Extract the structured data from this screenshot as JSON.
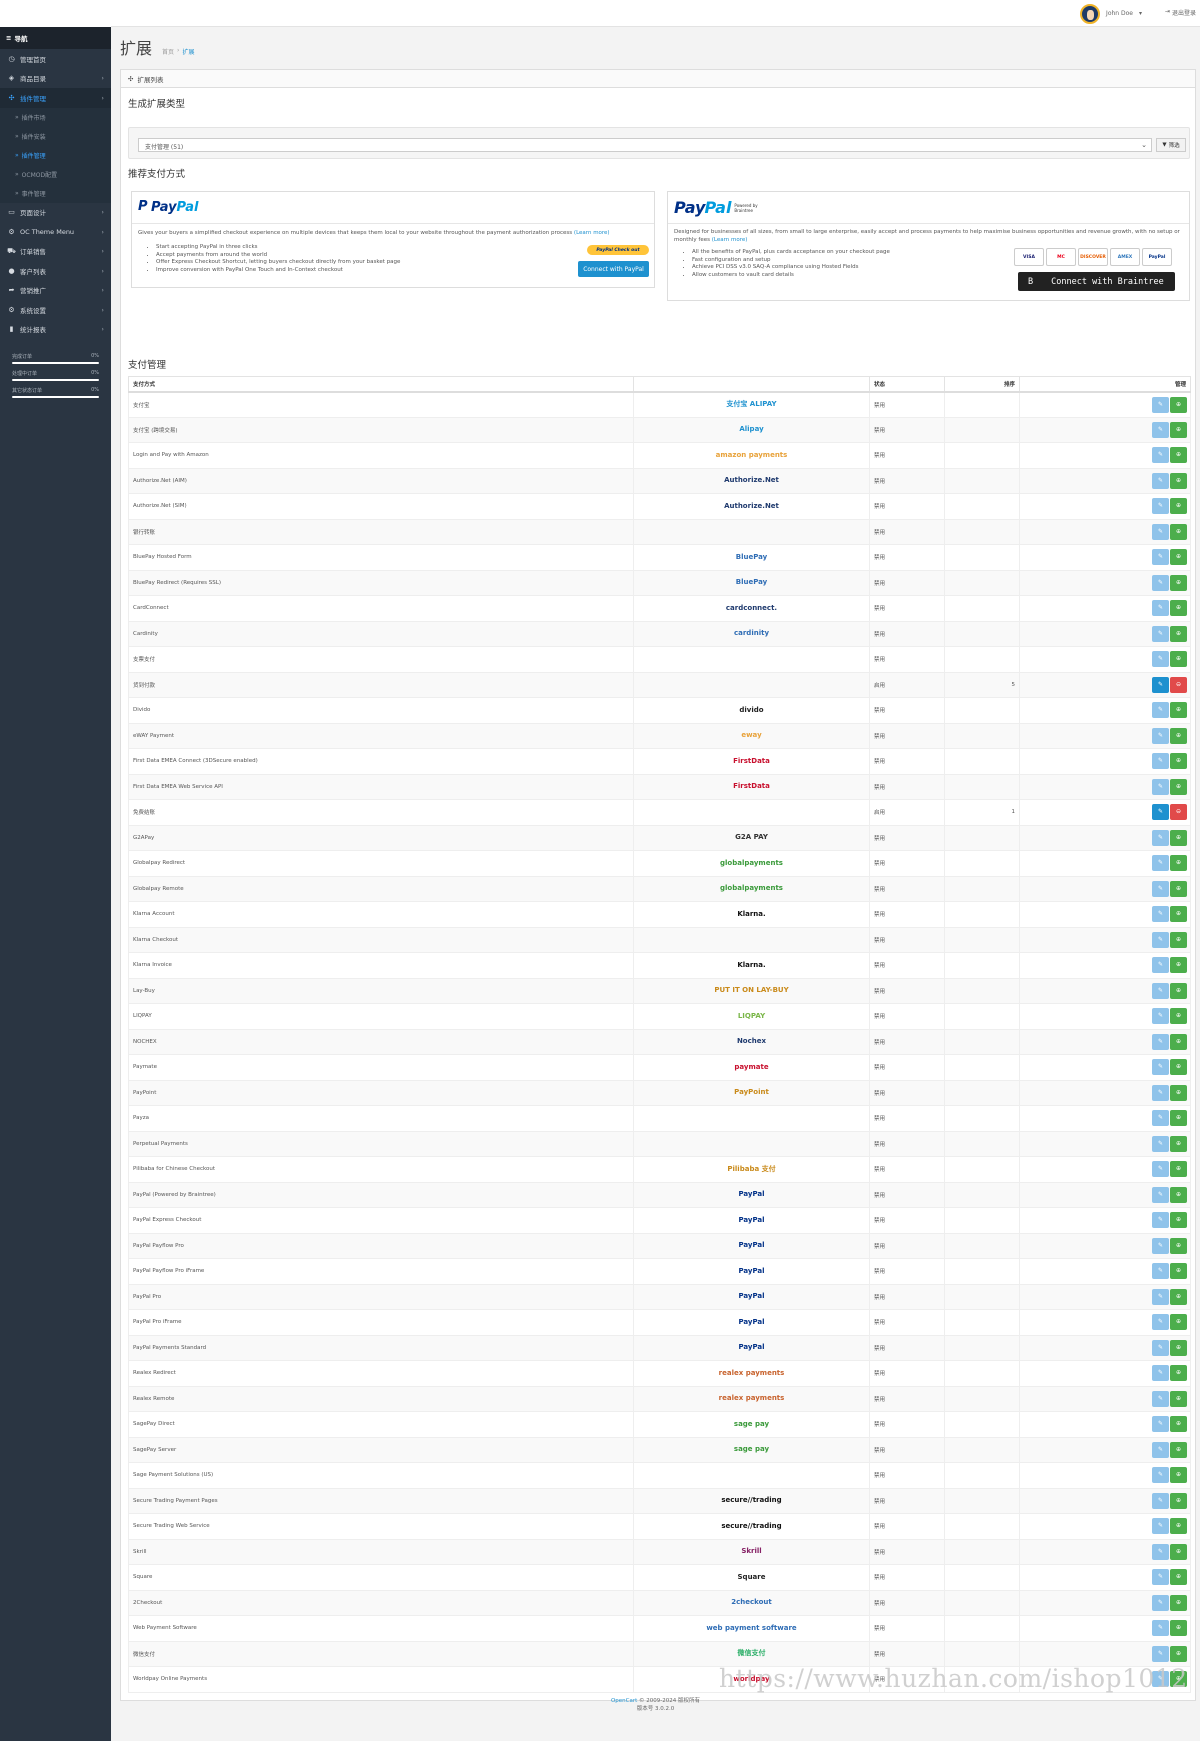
{
  "header": {
    "user_name": "John Doe",
    "logout": "退出登录"
  },
  "sidebar": {
    "nav_title": "导航",
    "items": [
      {
        "label": "管理首页",
        "icon": "dashboard-icon",
        "glyph": "◷",
        "has_children": false,
        "active": false
      },
      {
        "label": "商品目录",
        "icon": "tag-icon",
        "glyph": "◈",
        "has_children": true,
        "active": false
      },
      {
        "label": "插件管理",
        "icon": "puzzle-icon",
        "glyph": "✣",
        "has_children": true,
        "active": true,
        "children": [
          {
            "label": "插件市场",
            "active": false
          },
          {
            "label": "插件安装",
            "active": false
          },
          {
            "label": "插件管理",
            "active": true
          },
          {
            "label": "OCMOD配置",
            "active": false
          },
          {
            "label": "事件管理",
            "active": false
          }
        ]
      },
      {
        "label": "页面设计",
        "icon": "monitor-icon",
        "glyph": "▭",
        "has_children": true,
        "active": false
      },
      {
        "label": "OC Theme Menu",
        "icon": "gear-icon",
        "glyph": "⚙",
        "has_children": true,
        "active": false
      },
      {
        "label": "订单销售",
        "icon": "cart-icon",
        "glyph": "⛟",
        "has_children": true,
        "active": false
      },
      {
        "label": "客户列表",
        "icon": "user-icon",
        "glyph": "●",
        "has_children": true,
        "active": false
      },
      {
        "label": "营销推广",
        "icon": "share-icon",
        "glyph": "➦",
        "has_children": true,
        "active": false
      },
      {
        "label": "系统设置",
        "icon": "cog-icon",
        "glyph": "⚙",
        "has_children": true,
        "active": false
      },
      {
        "label": "统计报表",
        "icon": "bar-chart-icon",
        "glyph": "▮",
        "has_children": true,
        "active": false
      }
    ],
    "progress": [
      {
        "label": "完成订单",
        "value": "0%",
        "fraction": 0.0
      },
      {
        "label": "处理中订单",
        "value": "0%",
        "fraction": 0.0
      },
      {
        "label": "其它状态订单",
        "value": "0%",
        "fraction": 0.0
      }
    ]
  },
  "page": {
    "title": "扩展",
    "breadcrumb": [
      "首页",
      "扩展"
    ],
    "panel_title": "扩展列表",
    "type_section_title": "生成扩展类型",
    "type_select_value": "支付管理 (51)",
    "filter_button": "筛选",
    "recommended_title": "推荐支付方式",
    "payment_section_title": "支付管理"
  },
  "promo_paypal": {
    "logo_a": "Pay",
    "logo_b": "Pal",
    "description": "Gives your buyers a simplified checkout experience on multiple devices that keeps them local to your website throughout the payment authorization process",
    "learn_more": "(Learn more)",
    "bullets": [
      "Start accepting PayPal in three clicks",
      "Accept payments from around the world",
      "Offer Express Checkout Shortcut, letting buyers checkout directly from your basket page",
      "Improve conversion with PayPal One Touch and In-Context checkout"
    ],
    "checkout_button": "PayPal Check out",
    "connect_button": "Connect with PayPal"
  },
  "promo_braintree": {
    "logo_a": "Pay",
    "logo_b": "Pal",
    "powered_by": "Powered by Braintree",
    "description": "Designed for businesses of all sizes, from small to large enterprise, easily accept and process payments to help maximise business opportunities and revenue growth, with no setup or monthly fees",
    "learn_more": "(Learn more)",
    "bullets": [
      "All the benefits of PayPal, plus cards acceptance on your checkout page",
      "Fast configuration and setup",
      "Achieve PCI DSS v3.0 SAQ-A compliance using Hosted Fields",
      "Allow customers to vault card details"
    ],
    "cards": [
      "VISA",
      "MC",
      "DISCOVER",
      "AMEX",
      "PayPal"
    ],
    "connect_button": "Connect with Braintree",
    "connect_badge": "B"
  },
  "table": {
    "headers": [
      "支付方式",
      "",
      "状态",
      "排序",
      "管理"
    ],
    "rows": [
      {
        "name": "支付宝",
        "logo": "支付宝 ALIPAY",
        "logo_color": "#1e91cf",
        "status": "禁用",
        "sort": "",
        "installed": false
      },
      {
        "name": "支付宝 (跨境交易)",
        "logo": "Alipay",
        "logo_color": "#1e91cf",
        "status": "禁用",
        "sort": "",
        "installed": false
      },
      {
        "name": "Login and Pay with Amazon",
        "logo": "amazon payments",
        "logo_color": "#e8a23a",
        "status": "禁用",
        "sort": "",
        "installed": false
      },
      {
        "name": "Authorize.Net (AIM)",
        "logo": "Authorize.Net",
        "logo_color": "#1f3a6e",
        "status": "禁用",
        "sort": "",
        "installed": false
      },
      {
        "name": "Authorize.Net (SIM)",
        "logo": "Authorize.Net",
        "logo_color": "#1f3a6e",
        "status": "禁用",
        "sort": "",
        "installed": false
      },
      {
        "name": "银行转账",
        "logo": "",
        "logo_color": "#333",
        "status": "禁用",
        "sort": "",
        "installed": false
      },
      {
        "name": "BluePay Hosted Form",
        "logo": "BluePay",
        "logo_color": "#2f6db5",
        "status": "禁用",
        "sort": "",
        "installed": false
      },
      {
        "name": "BluePay Redirect (Requires SSL)",
        "logo": "BluePay",
        "logo_color": "#2f6db5",
        "status": "禁用",
        "sort": "",
        "installed": false
      },
      {
        "name": "CardConnect",
        "logo": "cardconnect.",
        "logo_color": "#1f3a6e",
        "status": "禁用",
        "sort": "",
        "installed": false
      },
      {
        "name": "Cardinity",
        "logo": "cardinity",
        "logo_color": "#2f6db5",
        "status": "禁用",
        "sort": "",
        "installed": false
      },
      {
        "name": "支票支付",
        "logo": "",
        "logo_color": "#333",
        "status": "禁用",
        "sort": "",
        "installed": false
      },
      {
        "name": "货到付款",
        "logo": "",
        "logo_color": "#333",
        "status": "启用",
        "sort": "5",
        "installed": true
      },
      {
        "name": "Divido",
        "logo": "divido",
        "logo_color": "#222",
        "status": "禁用",
        "sort": "",
        "installed": false
      },
      {
        "name": "eWAY Payment",
        "logo": "eway",
        "logo_color": "#e8a23a",
        "status": "禁用",
        "sort": "",
        "installed": false
      },
      {
        "name": "First Data EMEA Connect (3DSecure enabled)",
        "logo": "FirstData",
        "logo_color": "#c8102e",
        "status": "禁用",
        "sort": "",
        "installed": false
      },
      {
        "name": "First Data EMEA Web Service API",
        "logo": "FirstData",
        "logo_color": "#c8102e",
        "status": "禁用",
        "sort": "",
        "installed": false
      },
      {
        "name": "免费结账",
        "logo": "",
        "logo_color": "#333",
        "status": "启用",
        "sort": "1",
        "installed": true
      },
      {
        "name": "G2APay",
        "logo": "G2A PAY",
        "logo_color": "#333",
        "status": "禁用",
        "sort": "",
        "installed": false
      },
      {
        "name": "Globalpay Redirect",
        "logo": "globalpayments",
        "logo_color": "#3a9a3a",
        "status": "禁用",
        "sort": "",
        "installed": false
      },
      {
        "name": "Globalpay Remote",
        "logo": "globalpayments",
        "logo_color": "#3a9a3a",
        "status": "禁用",
        "sort": "",
        "installed": false
      },
      {
        "name": "Klarna Account",
        "logo": "Klarna.",
        "logo_color": "#111",
        "status": "禁用",
        "sort": "",
        "installed": false
      },
      {
        "name": "Klarna Checkout",
        "logo": "",
        "logo_color": "#111",
        "status": "禁用",
        "sort": "",
        "installed": false
      },
      {
        "name": "Klarna Invoice",
        "logo": "Klarna.",
        "logo_color": "#111",
        "status": "禁用",
        "sort": "",
        "installed": false
      },
      {
        "name": "Lay-Buy",
        "logo": "PUT IT ON LAY-BUY",
        "logo_color": "#c98a1a",
        "status": "禁用",
        "sort": "",
        "installed": false
      },
      {
        "name": "LIQPAY",
        "logo": "LIQPAY",
        "logo_color": "#7ab648",
        "status": "禁用",
        "sort": "",
        "installed": false
      },
      {
        "name": "NOCHEX",
        "logo": "Nochex",
        "logo_color": "#1f3a6e",
        "status": "禁用",
        "sort": "",
        "installed": false
      },
      {
        "name": "Paymate",
        "logo": "paymate",
        "logo_color": "#c8102e",
        "status": "禁用",
        "sort": "",
        "installed": false
      },
      {
        "name": "PayPoint",
        "logo": "PayPoint",
        "logo_color": "#c98a1a",
        "status": "禁用",
        "sort": "",
        "installed": false
      },
      {
        "name": "Payza",
        "logo": "",
        "logo_color": "#333",
        "status": "禁用",
        "sort": "",
        "installed": false
      },
      {
        "name": "Perpetual Payments",
        "logo": "",
        "logo_color": "#333",
        "status": "禁用",
        "sort": "",
        "installed": false
      },
      {
        "name": "Pilibaba for Chinese Checkout",
        "logo": "Pilibaba 支付",
        "logo_color": "#c98a1a",
        "status": "禁用",
        "sort": "",
        "installed": false
      },
      {
        "name": "PayPal (Powered by Braintree)",
        "logo": "PayPal",
        "logo_color": "#003087",
        "status": "禁用",
        "sort": "",
        "installed": false
      },
      {
        "name": "PayPal Express Checkout",
        "logo": "PayPal",
        "logo_color": "#003087",
        "status": "禁用",
        "sort": "",
        "installed": false
      },
      {
        "name": "PayPal Payflow Pro",
        "logo": "PayPal",
        "logo_color": "#003087",
        "status": "禁用",
        "sort": "",
        "installed": false
      },
      {
        "name": "PayPal Payflow Pro iFrame",
        "logo": "PayPal",
        "logo_color": "#003087",
        "status": "禁用",
        "sort": "",
        "installed": false
      },
      {
        "name": "PayPal Pro",
        "logo": "PayPal",
        "logo_color": "#003087",
        "status": "禁用",
        "sort": "",
        "installed": false
      },
      {
        "name": "PayPal Pro iFrame",
        "logo": "PayPal",
        "logo_color": "#003087",
        "status": "禁用",
        "sort": "",
        "installed": false
      },
      {
        "name": "PayPal Payments Standard",
        "logo": "PayPal",
        "logo_color": "#003087",
        "status": "禁用",
        "sort": "",
        "installed": false
      },
      {
        "name": "Realex Redirect",
        "logo": "realex payments",
        "logo_color": "#c8632e",
        "status": "禁用",
        "sort": "",
        "installed": false
      },
      {
        "name": "Realex Remote",
        "logo": "realex payments",
        "logo_color": "#c8632e",
        "status": "禁用",
        "sort": "",
        "installed": false
      },
      {
        "name": "SagePay Direct",
        "logo": "sage pay",
        "logo_color": "#3a9a3a",
        "status": "禁用",
        "sort": "",
        "installed": false
      },
      {
        "name": "SagePay Server",
        "logo": "sage pay",
        "logo_color": "#3a9a3a",
        "status": "禁用",
        "sort": "",
        "installed": false
      },
      {
        "name": "Sage Payment Solutions (US)",
        "logo": "",
        "logo_color": "#333",
        "status": "禁用",
        "sort": "",
        "installed": false
      },
      {
        "name": "Secure Trading Payment Pages",
        "logo": "secure//trading",
        "logo_color": "#111",
        "status": "禁用",
        "sort": "",
        "installed": false
      },
      {
        "name": "Secure Trading Web Service",
        "logo": "secure//trading",
        "logo_color": "#111",
        "status": "禁用",
        "sort": "",
        "installed": false
      },
      {
        "name": "Skrill",
        "logo": "Skrill",
        "logo_color": "#862165",
        "status": "禁用",
        "sort": "",
        "installed": false
      },
      {
        "name": "Square",
        "logo": "Square",
        "logo_color": "#222",
        "status": "禁用",
        "sort": "",
        "installed": false
      },
      {
        "name": "2Checkout",
        "logo": "2checkout",
        "logo_color": "#2f6db5",
        "status": "禁用",
        "sort": "",
        "installed": false
      },
      {
        "name": "Web Payment Software",
        "logo": "web payment software",
        "logo_color": "#2f6db5",
        "status": "禁用",
        "sort": "",
        "installed": false
      },
      {
        "name": "微信支付",
        "logo": "微信支付",
        "logo_color": "#2aae67",
        "status": "禁用",
        "sort": "",
        "installed": false
      },
      {
        "name": "Worldpay Online Payments",
        "logo": "worldpay",
        "logo_color": "#c8102e",
        "status": "禁用",
        "sort": "",
        "installed": false
      }
    ]
  },
  "footer": {
    "brand": "OpenCart",
    "copyright": "© 2009-2024 版权所有",
    "version": "版本号 3.0.2.0"
  },
  "watermark": "https://www.huzhan.com/ishop1012"
}
